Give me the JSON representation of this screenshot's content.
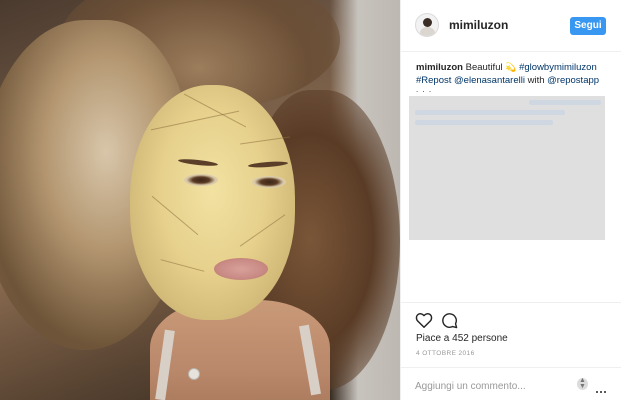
{
  "post": {
    "author": {
      "username": "mimiluzon",
      "avatar_icon": "avatar-icon"
    },
    "follow_label": "Segui",
    "caption": {
      "username": "mimiluzon",
      "text_1": "Beautiful",
      "emoji": "💫",
      "hashtag_1": "#glowbymimiluzon",
      "hashtag_2": "#Repost",
      "mention_1": "@elenasantarelli",
      "text_2": "with",
      "mention_2": "@repostapp",
      "more": ". . ."
    },
    "likes_text": "Piace a 452 persone",
    "date_text": "4 OTTOBRE 2016",
    "comment_placeholder": "Aggiungi un commento...",
    "icons": {
      "like": "heart-icon",
      "comment": "comment-bubble-icon",
      "scroll": "scroll-arrows-icon",
      "more": "more-options-icon"
    },
    "colors": {
      "follow_button": "#3897f0",
      "link": "#003569",
      "text": "#262626",
      "muted": "#999999"
    }
  }
}
